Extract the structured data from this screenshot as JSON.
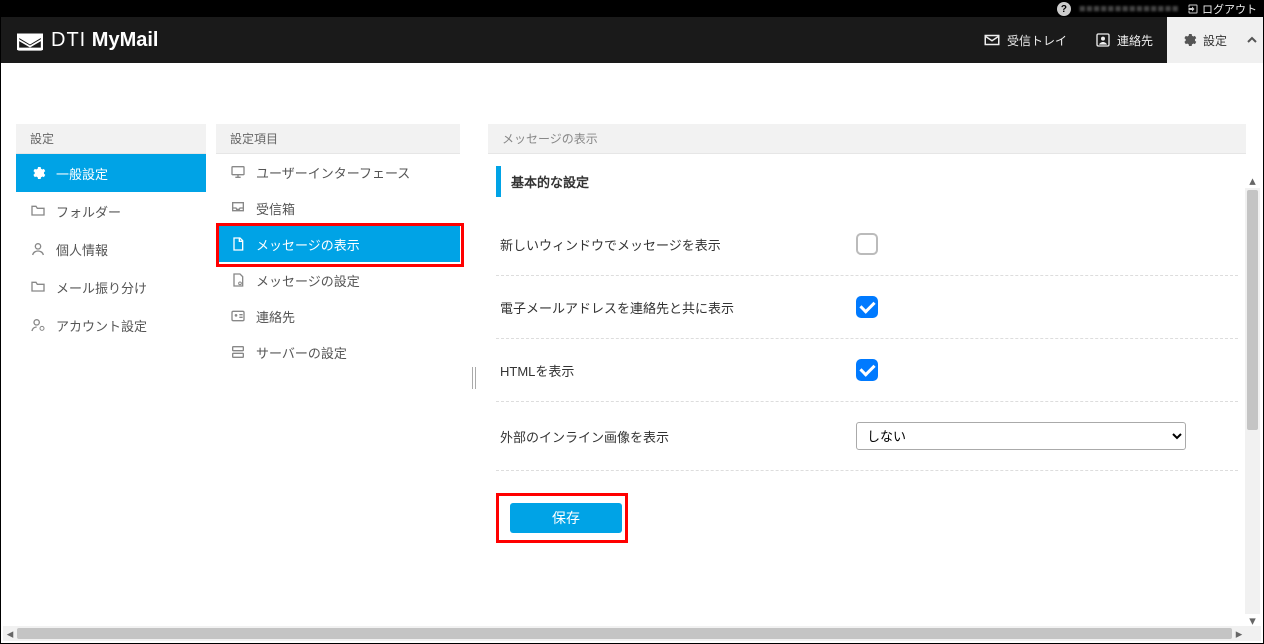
{
  "topbar": {
    "logout": "ログアウト"
  },
  "brand": {
    "dti": "DTI",
    "mymail": "MyMail"
  },
  "nav": {
    "inbox": "受信トレイ",
    "contacts": "連絡先",
    "settings": "設定"
  },
  "col1": {
    "header": "設定",
    "items": [
      {
        "label": "一般設定",
        "icon": "gear"
      },
      {
        "label": "フォルダー",
        "icon": "folder"
      },
      {
        "label": "個人情報",
        "icon": "person"
      },
      {
        "label": "メール振り分け",
        "icon": "folder"
      },
      {
        "label": "アカウント設定",
        "icon": "person-gear"
      }
    ],
    "active_index": 0
  },
  "col2": {
    "header": "設定項目",
    "items": [
      {
        "label": "ユーザーインターフェース",
        "icon": "monitor"
      },
      {
        "label": "受信箱",
        "icon": "inbox"
      },
      {
        "label": "メッセージの表示",
        "icon": "doc"
      },
      {
        "label": "メッセージの設定",
        "icon": "doc-gear"
      },
      {
        "label": "連絡先",
        "icon": "card"
      },
      {
        "label": "サーバーの設定",
        "icon": "server"
      }
    ],
    "active_index": 2
  },
  "form": {
    "header": "メッセージの表示",
    "section_title": "基本的な設定",
    "rows": [
      {
        "label": "新しいウィンドウでメッセージを表示",
        "type": "checkbox",
        "checked": false
      },
      {
        "label": "電子メールアドレスを連絡先と共に表示",
        "type": "checkbox",
        "checked": true
      },
      {
        "label": "HTMLを表示",
        "type": "checkbox",
        "checked": true
      },
      {
        "label": "外部のインライン画像を表示",
        "type": "select",
        "value": "しない"
      }
    ],
    "save": "保存"
  },
  "colors": {
    "accent": "#00a3e6",
    "checkbox_on": "#007aff",
    "highlight": "#ff0000"
  }
}
